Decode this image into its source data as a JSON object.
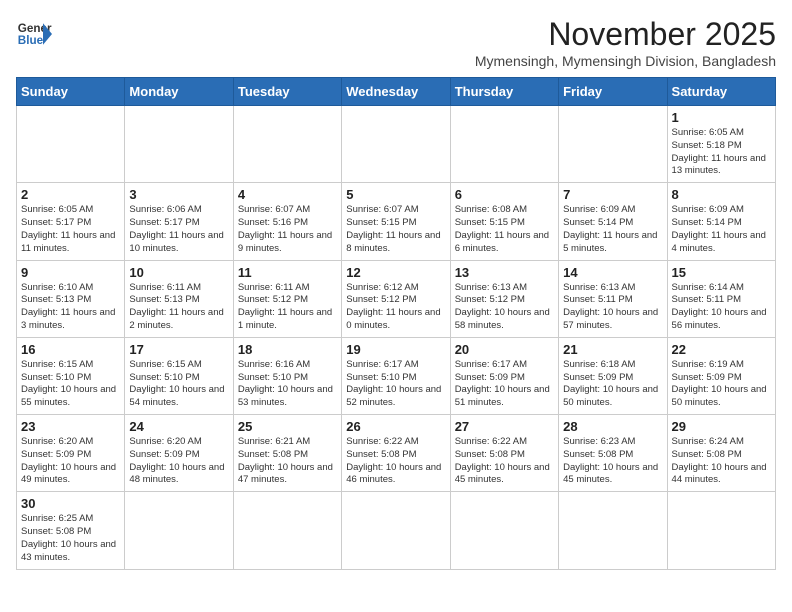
{
  "header": {
    "logo_line1": "General",
    "logo_line2": "Blue",
    "month": "November 2025",
    "location": "Mymensingh, Mymensingh Division, Bangladesh"
  },
  "weekdays": [
    "Sunday",
    "Monday",
    "Tuesday",
    "Wednesday",
    "Thursday",
    "Friday",
    "Saturday"
  ],
  "weeks": [
    [
      {
        "day": "",
        "info": ""
      },
      {
        "day": "",
        "info": ""
      },
      {
        "day": "",
        "info": ""
      },
      {
        "day": "",
        "info": ""
      },
      {
        "day": "",
        "info": ""
      },
      {
        "day": "",
        "info": ""
      },
      {
        "day": "1",
        "info": "Sunrise: 6:05 AM\nSunset: 5:18 PM\nDaylight: 11 hours\nand 13 minutes."
      }
    ],
    [
      {
        "day": "2",
        "info": "Sunrise: 6:05 AM\nSunset: 5:17 PM\nDaylight: 11 hours\nand 11 minutes."
      },
      {
        "day": "3",
        "info": "Sunrise: 6:06 AM\nSunset: 5:17 PM\nDaylight: 11 hours\nand 10 minutes."
      },
      {
        "day": "4",
        "info": "Sunrise: 6:07 AM\nSunset: 5:16 PM\nDaylight: 11 hours\nand 9 minutes."
      },
      {
        "day": "5",
        "info": "Sunrise: 6:07 AM\nSunset: 5:15 PM\nDaylight: 11 hours\nand 8 minutes."
      },
      {
        "day": "6",
        "info": "Sunrise: 6:08 AM\nSunset: 5:15 PM\nDaylight: 11 hours\nand 6 minutes."
      },
      {
        "day": "7",
        "info": "Sunrise: 6:09 AM\nSunset: 5:14 PM\nDaylight: 11 hours\nand 5 minutes."
      },
      {
        "day": "8",
        "info": "Sunrise: 6:09 AM\nSunset: 5:14 PM\nDaylight: 11 hours\nand 4 minutes."
      }
    ],
    [
      {
        "day": "9",
        "info": "Sunrise: 6:10 AM\nSunset: 5:13 PM\nDaylight: 11 hours\nand 3 minutes."
      },
      {
        "day": "10",
        "info": "Sunrise: 6:11 AM\nSunset: 5:13 PM\nDaylight: 11 hours\nand 2 minutes."
      },
      {
        "day": "11",
        "info": "Sunrise: 6:11 AM\nSunset: 5:12 PM\nDaylight: 11 hours\nand 1 minute."
      },
      {
        "day": "12",
        "info": "Sunrise: 6:12 AM\nSunset: 5:12 PM\nDaylight: 11 hours\nand 0 minutes."
      },
      {
        "day": "13",
        "info": "Sunrise: 6:13 AM\nSunset: 5:12 PM\nDaylight: 10 hours\nand 58 minutes."
      },
      {
        "day": "14",
        "info": "Sunrise: 6:13 AM\nSunset: 5:11 PM\nDaylight: 10 hours\nand 57 minutes."
      },
      {
        "day": "15",
        "info": "Sunrise: 6:14 AM\nSunset: 5:11 PM\nDaylight: 10 hours\nand 56 minutes."
      }
    ],
    [
      {
        "day": "16",
        "info": "Sunrise: 6:15 AM\nSunset: 5:10 PM\nDaylight: 10 hours\nand 55 minutes."
      },
      {
        "day": "17",
        "info": "Sunrise: 6:15 AM\nSunset: 5:10 PM\nDaylight: 10 hours\nand 54 minutes."
      },
      {
        "day": "18",
        "info": "Sunrise: 6:16 AM\nSunset: 5:10 PM\nDaylight: 10 hours\nand 53 minutes."
      },
      {
        "day": "19",
        "info": "Sunrise: 6:17 AM\nSunset: 5:10 PM\nDaylight: 10 hours\nand 52 minutes."
      },
      {
        "day": "20",
        "info": "Sunrise: 6:17 AM\nSunset: 5:09 PM\nDaylight: 10 hours\nand 51 minutes."
      },
      {
        "day": "21",
        "info": "Sunrise: 6:18 AM\nSunset: 5:09 PM\nDaylight: 10 hours\nand 50 minutes."
      },
      {
        "day": "22",
        "info": "Sunrise: 6:19 AM\nSunset: 5:09 PM\nDaylight: 10 hours\nand 50 minutes."
      }
    ],
    [
      {
        "day": "23",
        "info": "Sunrise: 6:20 AM\nSunset: 5:09 PM\nDaylight: 10 hours\nand 49 minutes."
      },
      {
        "day": "24",
        "info": "Sunrise: 6:20 AM\nSunset: 5:09 PM\nDaylight: 10 hours\nand 48 minutes."
      },
      {
        "day": "25",
        "info": "Sunrise: 6:21 AM\nSunset: 5:08 PM\nDaylight: 10 hours\nand 47 minutes."
      },
      {
        "day": "26",
        "info": "Sunrise: 6:22 AM\nSunset: 5:08 PM\nDaylight: 10 hours\nand 46 minutes."
      },
      {
        "day": "27",
        "info": "Sunrise: 6:22 AM\nSunset: 5:08 PM\nDaylight: 10 hours\nand 45 minutes."
      },
      {
        "day": "28",
        "info": "Sunrise: 6:23 AM\nSunset: 5:08 PM\nDaylight: 10 hours\nand 45 minutes."
      },
      {
        "day": "29",
        "info": "Sunrise: 6:24 AM\nSunset: 5:08 PM\nDaylight: 10 hours\nand 44 minutes."
      }
    ],
    [
      {
        "day": "30",
        "info": "Sunrise: 6:25 AM\nSunset: 5:08 PM\nDaylight: 10 hours\nand 43 minutes."
      },
      {
        "day": "",
        "info": ""
      },
      {
        "day": "",
        "info": ""
      },
      {
        "day": "",
        "info": ""
      },
      {
        "day": "",
        "info": ""
      },
      {
        "day": "",
        "info": ""
      },
      {
        "day": "",
        "info": ""
      }
    ]
  ]
}
